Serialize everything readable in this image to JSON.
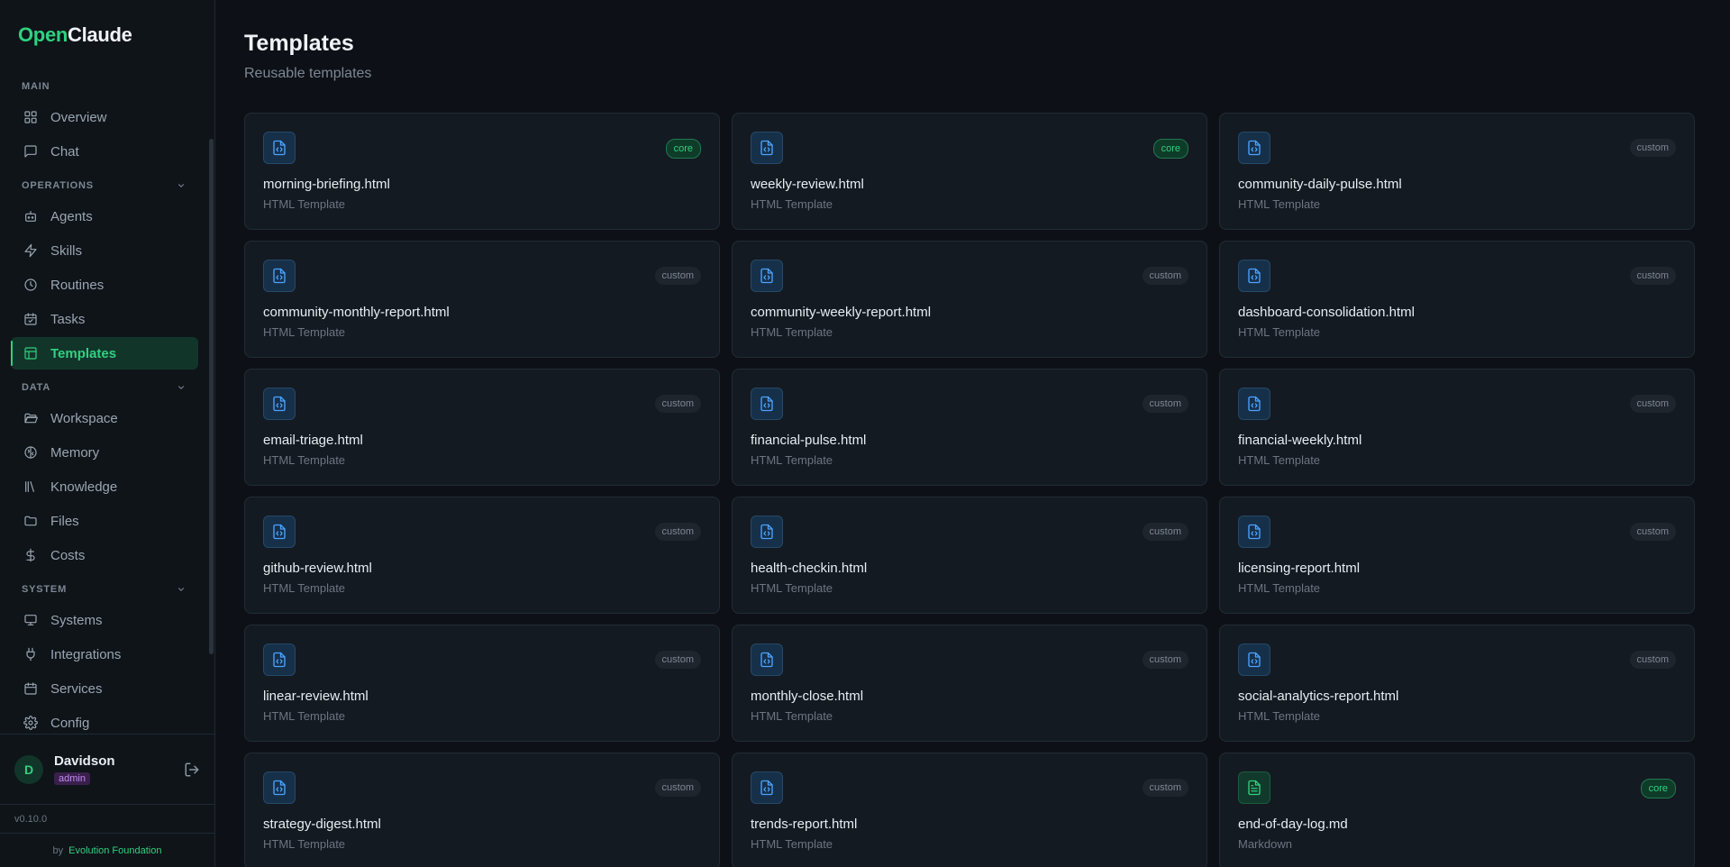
{
  "brand": {
    "open": "Open",
    "claude": "Claude"
  },
  "sidebar": {
    "sections": [
      {
        "title": "MAIN",
        "collapsible": false,
        "items": [
          {
            "label": "Overview",
            "icon": "grid-icon"
          },
          {
            "label": "Chat",
            "icon": "chat-icon"
          }
        ]
      },
      {
        "title": "OPERATIONS",
        "collapsible": true,
        "items": [
          {
            "label": "Agents",
            "icon": "bot-icon"
          },
          {
            "label": "Skills",
            "icon": "bolt-icon"
          },
          {
            "label": "Routines",
            "icon": "clock-icon"
          },
          {
            "label": "Tasks",
            "icon": "calendar-check-icon"
          },
          {
            "label": "Templates",
            "icon": "layout-icon",
            "active": true
          }
        ]
      },
      {
        "title": "DATA",
        "collapsible": true,
        "items": [
          {
            "label": "Workspace",
            "icon": "folder-open-icon"
          },
          {
            "label": "Memory",
            "icon": "brain-icon"
          },
          {
            "label": "Knowledge",
            "icon": "library-icon"
          },
          {
            "label": "Files",
            "icon": "folder-icon"
          },
          {
            "label": "Costs",
            "icon": "dollar-icon"
          }
        ]
      },
      {
        "title": "SYSTEM",
        "collapsible": true,
        "items": [
          {
            "label": "Systems",
            "icon": "monitor-icon"
          },
          {
            "label": "Integrations",
            "icon": "plug-icon"
          },
          {
            "label": "Services",
            "icon": "calendar-icon"
          },
          {
            "label": "Config",
            "icon": "gear-icon"
          }
        ]
      }
    ]
  },
  "user": {
    "initial": "D",
    "name": "Davidson",
    "role": "admin"
  },
  "footer": {
    "version": "v0.10.0",
    "by": "by",
    "org": "Evolution Foundation"
  },
  "page": {
    "title": "Templates",
    "subtitle": "Reusable templates"
  },
  "colors": {
    "accent": "#2fd17f",
    "background": "#0d1117",
    "card": "#141a21"
  },
  "templates": [
    {
      "name": "morning-briefing.html",
      "type": "HTML Template",
      "badge": "core",
      "kind": "html"
    },
    {
      "name": "weekly-review.html",
      "type": "HTML Template",
      "badge": "core",
      "kind": "html"
    },
    {
      "name": "community-daily-pulse.html",
      "type": "HTML Template",
      "badge": "custom",
      "kind": "html"
    },
    {
      "name": "community-monthly-report.html",
      "type": "HTML Template",
      "badge": "custom",
      "kind": "html"
    },
    {
      "name": "community-weekly-report.html",
      "type": "HTML Template",
      "badge": "custom",
      "kind": "html"
    },
    {
      "name": "dashboard-consolidation.html",
      "type": "HTML Template",
      "badge": "custom",
      "kind": "html"
    },
    {
      "name": "email-triage.html",
      "type": "HTML Template",
      "badge": "custom",
      "kind": "html"
    },
    {
      "name": "financial-pulse.html",
      "type": "HTML Template",
      "badge": "custom",
      "kind": "html"
    },
    {
      "name": "financial-weekly.html",
      "type": "HTML Template",
      "badge": "custom",
      "kind": "html"
    },
    {
      "name": "github-review.html",
      "type": "HTML Template",
      "badge": "custom",
      "kind": "html"
    },
    {
      "name": "health-checkin.html",
      "type": "HTML Template",
      "badge": "custom",
      "kind": "html"
    },
    {
      "name": "licensing-report.html",
      "type": "HTML Template",
      "badge": "custom",
      "kind": "html"
    },
    {
      "name": "linear-review.html",
      "type": "HTML Template",
      "badge": "custom",
      "kind": "html"
    },
    {
      "name": "monthly-close.html",
      "type": "HTML Template",
      "badge": "custom",
      "kind": "html"
    },
    {
      "name": "social-analytics-report.html",
      "type": "HTML Template",
      "badge": "custom",
      "kind": "html"
    },
    {
      "name": "strategy-digest.html",
      "type": "HTML Template",
      "badge": "custom",
      "kind": "html"
    },
    {
      "name": "trends-report.html",
      "type": "HTML Template",
      "badge": "custom",
      "kind": "html"
    },
    {
      "name": "end-of-day-log.md",
      "type": "Markdown",
      "badge": "core",
      "kind": "md"
    }
  ]
}
